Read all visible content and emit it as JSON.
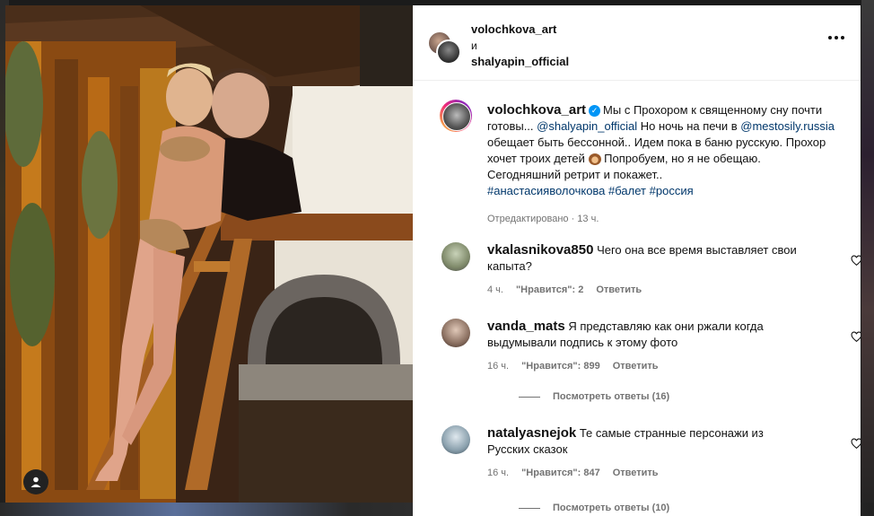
{
  "post": {
    "header": {
      "user1": "volochkova_art",
      "and": "и",
      "user2": "shalyapin_official"
    },
    "caption": {
      "username": "volochkova_art",
      "text_a": "Мы с Прохором к священному сну почти готовы... ",
      "mention1": "@shalyapin_official",
      "text_b": " Но ночь на печи в ",
      "mention2": "@mestosily.russia",
      "text_c": " обещает быть бессонной.. Идем пока в баню русскую. Прохор хочет троих детей ",
      "text_d": " Попробуем, но я не обещаю. Сегодняшний ретрит и покажет..",
      "tags": [
        "#анастасияволочкова",
        "#балет",
        "#россия"
      ],
      "edited": "Отредактировано",
      "time": "13 ч."
    },
    "comments": [
      {
        "username": "vkalasnikova850",
        "text": "Чего она все время выставляет свои капыта?",
        "time": "4 ч.",
        "likes": "\"Нравится\": 2",
        "reply": "Ответить"
      },
      {
        "username": "vanda_mats",
        "text": "Я представляю как они ржали когда выдумывали подпись к этому фото",
        "time": "16 ч.",
        "likes": "\"Нравится\": 899",
        "reply": "Ответить",
        "view_replies": "Посмотреть ответы (16)"
      },
      {
        "username": "natalyasnejok",
        "text": "Те самые странные персонажи из Русских сказок",
        "time": "16 ч.",
        "likes": "\"Нравится\": 847",
        "reply": "Ответить",
        "view_replies": "Посмотреть ответы (10)"
      }
    ]
  },
  "colors": {
    "link": "#00376b",
    "verified": "#0095f6",
    "meta": "#737373"
  },
  "icons": [
    "more-icon",
    "verified-icon",
    "heart-icon",
    "person-tag-icon"
  ]
}
